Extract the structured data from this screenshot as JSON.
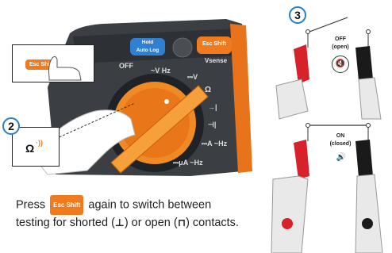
{
  "step_left": "2",
  "step_right": "3",
  "device": {
    "btn_hold": "Hold",
    "btn_autolog": "Auto Log",
    "btn_esc": "Esc Shift",
    "label_vsense": "Vsense",
    "dial_off": "OFF",
    "dial_v_hz": "~V Hz",
    "dial_v": "⎓V",
    "dial_ohm": "Ω",
    "dial_diode": "→|",
    "dial_cap": "⊣|",
    "dial_a": "⎓A ~Hz",
    "dial_ua": "⎓μA ~Hz"
  },
  "callout_top": {
    "button_label": "Esc Shift"
  },
  "callout_bottom": {
    "symbol": "Ω",
    "sound": "·))"
  },
  "states": {
    "off_label": "OFF",
    "off_sub": "(open)",
    "on_label": "ON",
    "on_sub": "(closed)"
  },
  "caption": {
    "part1": "Press",
    "button": "Esc Shift",
    "part2": "again to switch between testing for shorted (",
    "sym_short": "⊥",
    "part3": ") or open (",
    "sym_open": "⊓",
    "part4": ") contacts."
  },
  "colors": {
    "badge_border": "#2a7fc4",
    "orange": "#f07a1e",
    "device_body": "#3b3f44",
    "probe_red": "#d7212b",
    "probe_black": "#1a1a1a"
  }
}
